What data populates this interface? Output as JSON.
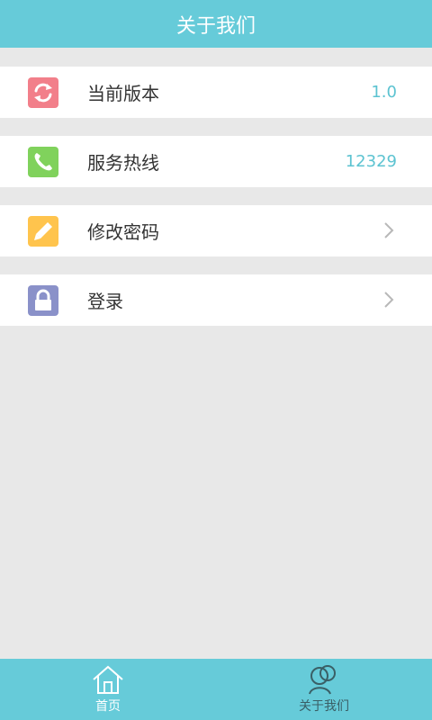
{
  "header": {
    "title": "关于我们"
  },
  "rows": [
    {
      "label": "当前版本",
      "value": "1.0",
      "icon": "refresh-icon",
      "icon_color": "#f27f8a"
    },
    {
      "label": "服务热线",
      "value": "12329",
      "icon": "phone-icon",
      "icon_color": "#80d25c"
    },
    {
      "label": "修改密码",
      "icon": "pencil-icon",
      "icon_color": "#ffc44d"
    },
    {
      "label": "登录",
      "icon": "lock-icon",
      "icon_color": "#8a91c9"
    }
  ],
  "tabs": [
    {
      "label": "首页",
      "icon": "home-icon",
      "active": true
    },
    {
      "label": "关于我们",
      "icon": "people-icon",
      "active": false
    }
  ],
  "colors": {
    "accent": "#66cbd9",
    "value_text": "#5cc3d1",
    "background": "#e8e8e8"
  }
}
